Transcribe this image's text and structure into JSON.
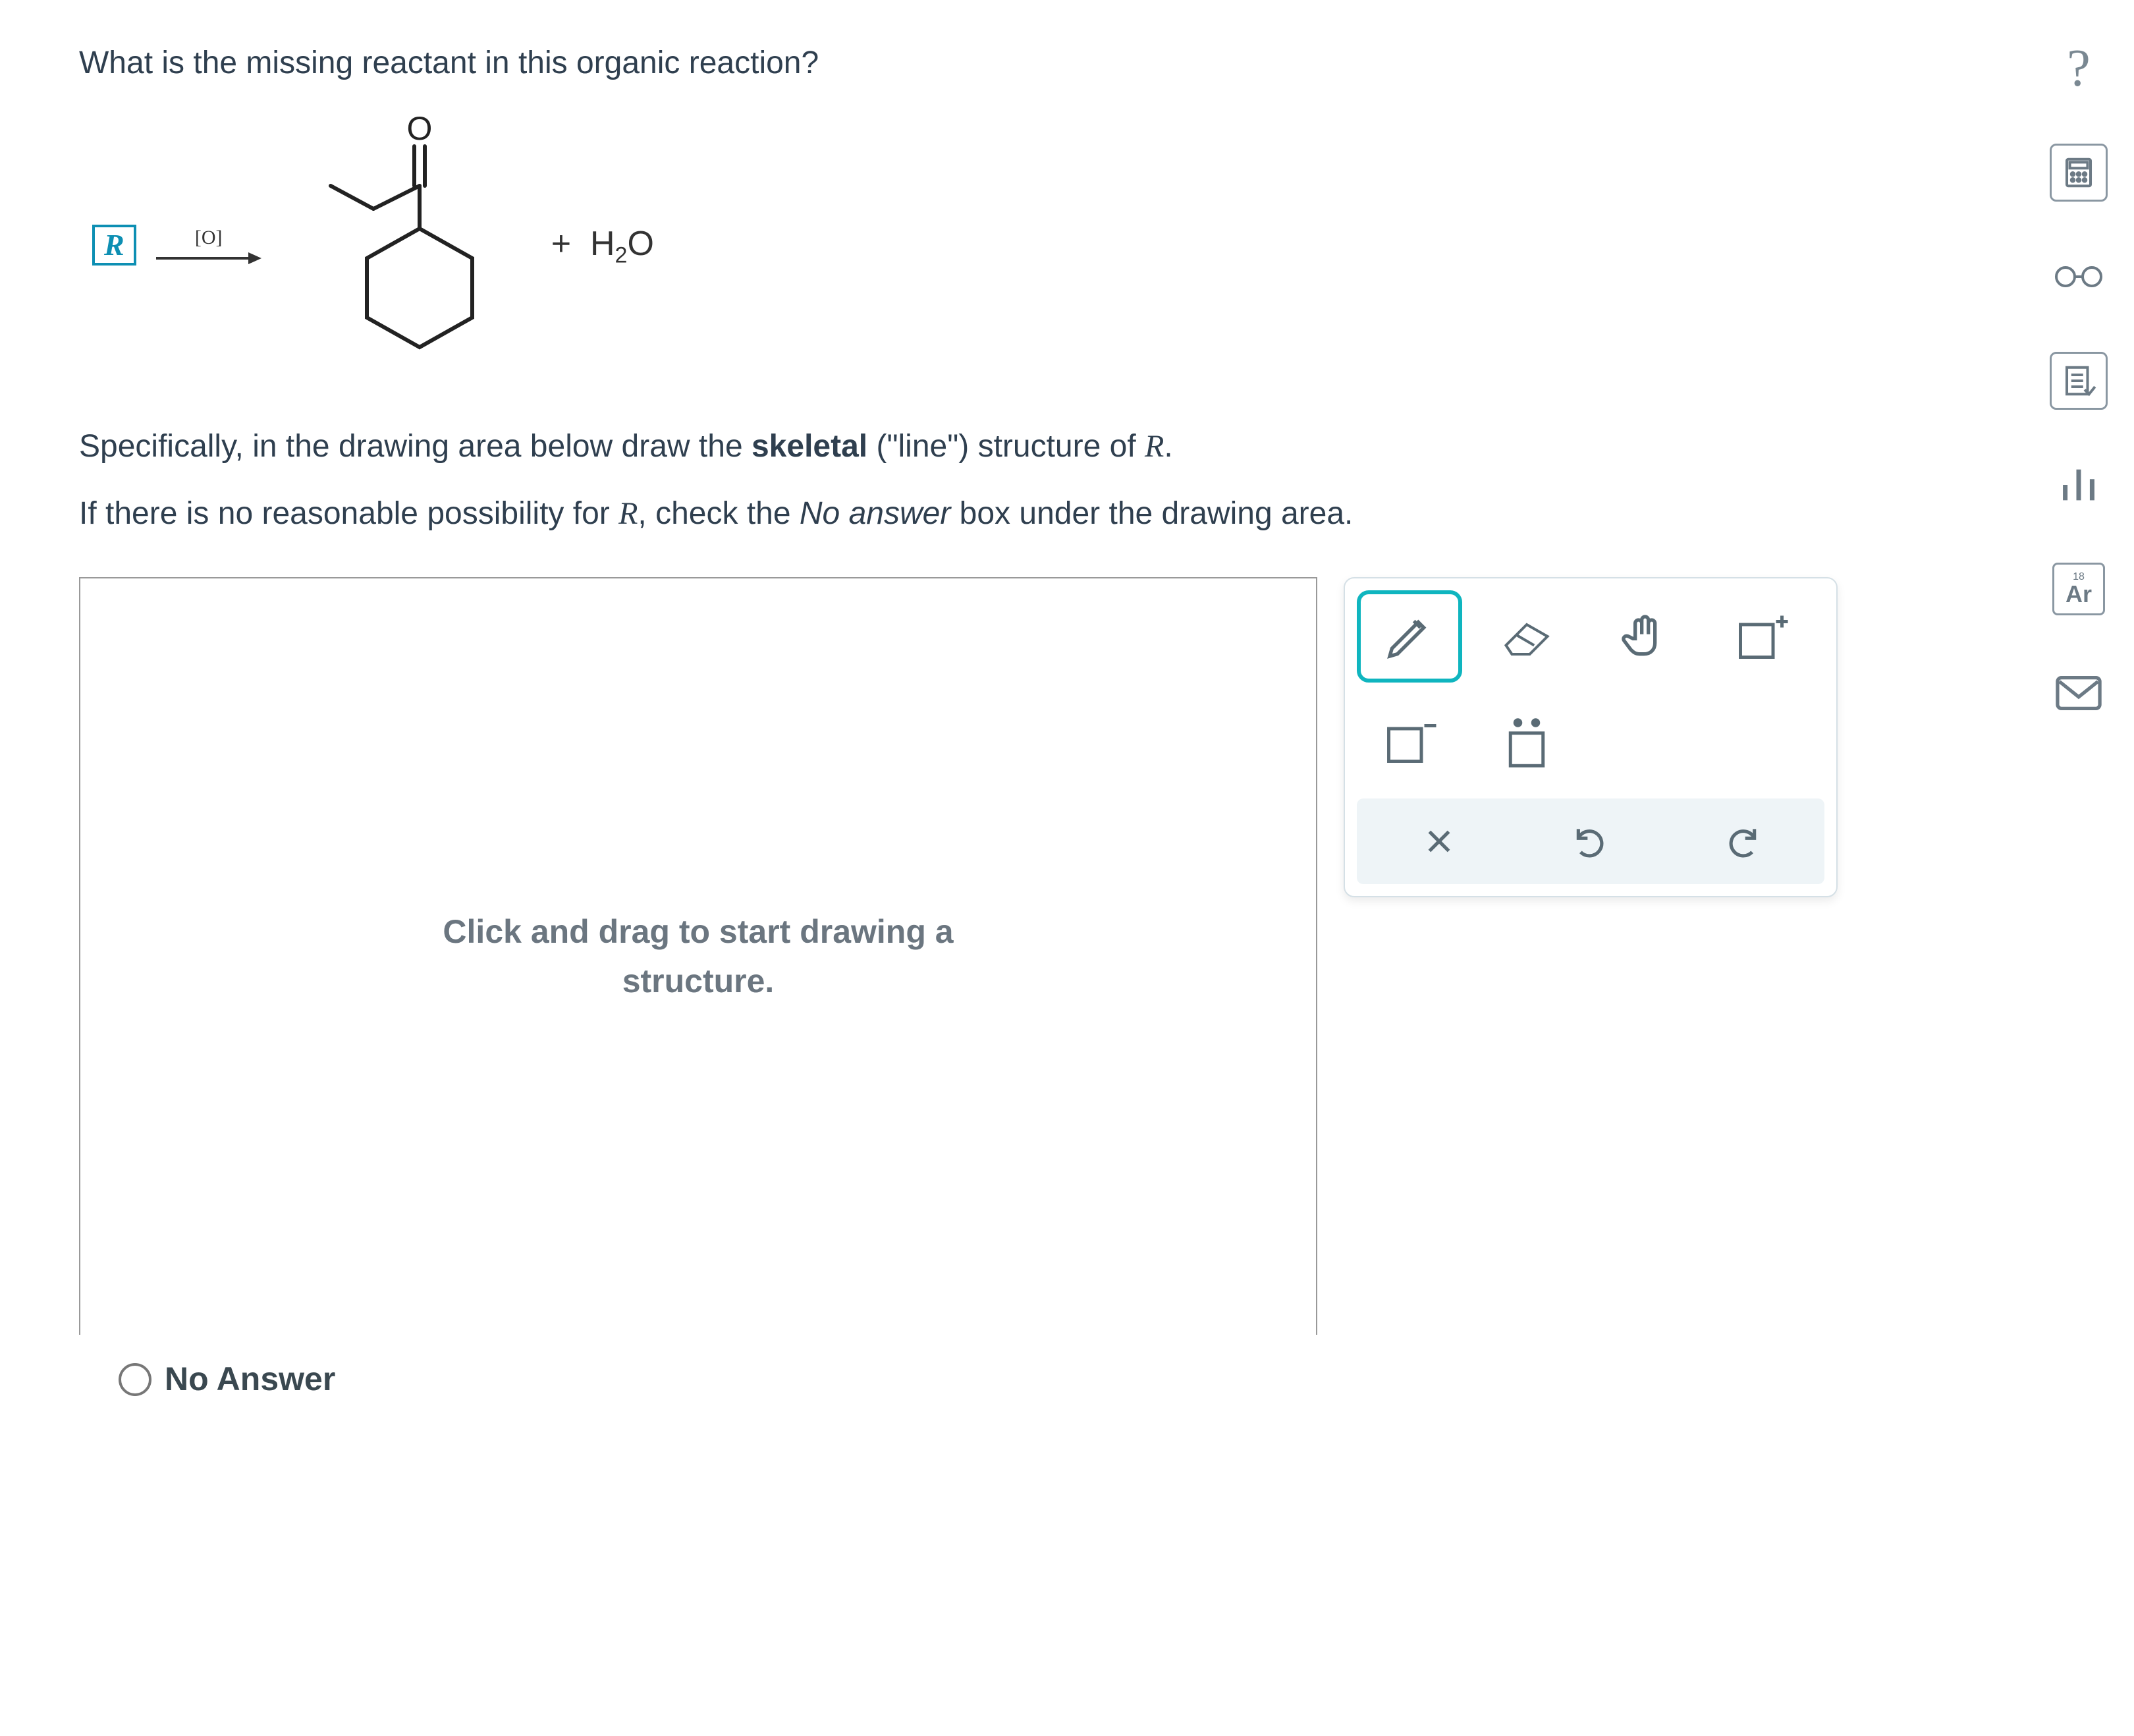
{
  "question": {
    "title": "What is the missing reactant in this organic reaction?",
    "arrow_label": "[O]",
    "second_product": "+  H₂O",
    "instruction_line1_prefix": "Specifically, in the drawing area below draw the ",
    "instruction_line1_bold": "skeletal",
    "instruction_line1_paren": " (\"line\") structure of ",
    "instruction_line1_R": "R",
    "instruction_line1_suffix": ".",
    "instruction_line2_prefix": "If there is no reasonable possibility for ",
    "instruction_line2_R": "R",
    "instruction_line2_mid": ", check the ",
    "instruction_line2_italic": "No answer",
    "instruction_line2_suffix": " box under the drawing area."
  },
  "reactant_box_label": "R",
  "drawing_area_placeholder": "Click and drag to start drawing a\nstructure.",
  "no_answer_label": "No Answer",
  "toolbox": {
    "tools": [
      {
        "name": "pencil",
        "selected": true
      },
      {
        "name": "eraser",
        "selected": false
      },
      {
        "name": "hand",
        "selected": false
      },
      {
        "name": "charge-plus",
        "selected": false
      },
      {
        "name": "charge-minus",
        "selected": false
      },
      {
        "name": "lone-pair",
        "selected": false
      }
    ],
    "bottom": [
      {
        "name": "clear"
      },
      {
        "name": "undo"
      },
      {
        "name": "redo"
      }
    ]
  },
  "side_rail": [
    {
      "name": "help"
    },
    {
      "name": "calculator"
    },
    {
      "name": "glasses"
    },
    {
      "name": "checklist"
    },
    {
      "name": "bar-chart"
    },
    {
      "name": "periodic-table",
      "label_small": "18",
      "label_big": "Ar"
    },
    {
      "name": "envelope"
    }
  ]
}
